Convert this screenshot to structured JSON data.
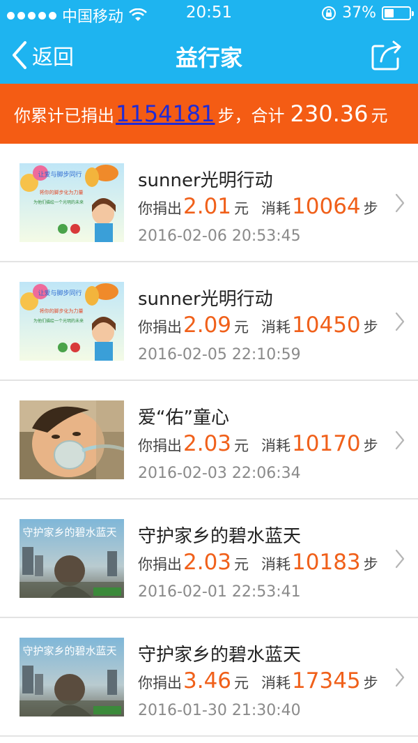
{
  "status_bar": {
    "carrier": "中国移动",
    "time": "20:51",
    "battery": "37%",
    "battery_level": 0.37
  },
  "nav": {
    "back_label": "返回",
    "title": "益行家",
    "back_icon": "chevron-left-icon",
    "share_icon": "share-icon"
  },
  "summary": {
    "prefix": "你累计已捐出",
    "steps": "1154181",
    "steps_suffix": "步，合计",
    "amount": "230.36",
    "amount_unit": "元"
  },
  "labels": {
    "donated": "你捐出",
    "yuan": "元",
    "consumed": "消耗",
    "step_unit": "步"
  },
  "items": [
    {
      "title": "sunner光明行动",
      "amount": "2.01",
      "steps": "10064",
      "date": "2016-02-06 20:53:45",
      "image": "sunner"
    },
    {
      "title": "sunner光明行动",
      "amount": "2.09",
      "steps": "10450",
      "date": "2016-02-05 22:10:59",
      "image": "sunner"
    },
    {
      "title": "爱“佑”童心",
      "amount": "2.03",
      "steps": "10170",
      "date": "2016-02-03 22:06:34",
      "image": "child"
    },
    {
      "title": "守护家乡的碧水蓝天",
      "amount": "2.03",
      "steps": "10183",
      "date": "2016-02-01 22:53:41",
      "image": "sky"
    },
    {
      "title": "守护家乡的碧水蓝天",
      "amount": "3.46",
      "steps": "17345",
      "date": "2016-01-30 21:30:40",
      "image": "sky"
    }
  ],
  "image_text": {
    "sunner_line1": "让爱与脚步同行",
    "sunner_line2": "将你的脚步化为力量",
    "sunner_line3": "为他们描绘一个光明的未来",
    "sky_text": "守护家乡的碧水蓝天"
  },
  "colors": {
    "header": "#1eb4f0",
    "banner": "#f45c14",
    "accent": "#f0601a",
    "link": "#1f2bd6"
  }
}
